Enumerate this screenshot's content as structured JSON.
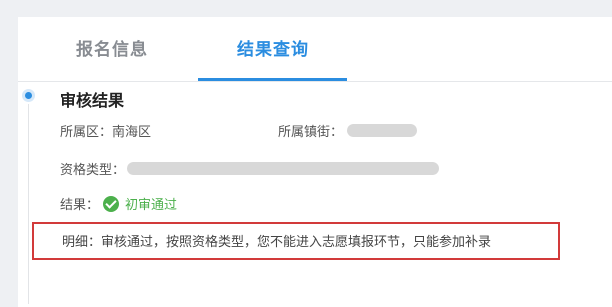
{
  "tabs": [
    {
      "label": "报名信息",
      "active": false
    },
    {
      "label": "结果查询",
      "active": true
    }
  ],
  "colors": {
    "accent": "#2b8de0",
    "success": "#4cb04c",
    "highlight_border": "#d23a3a"
  },
  "section": {
    "title": "审核结果",
    "district_label": "所属区：",
    "district_value": "南海区",
    "street_label": "所属镇街：",
    "qualification_label": "资格类型：",
    "result_label": "结果：",
    "result_icon": "check-circle-icon",
    "result_value": "初审通过",
    "detail_text": "明细：审核通过，按照资格类型，您不能进入志愿填报环节，只能参加补录"
  }
}
